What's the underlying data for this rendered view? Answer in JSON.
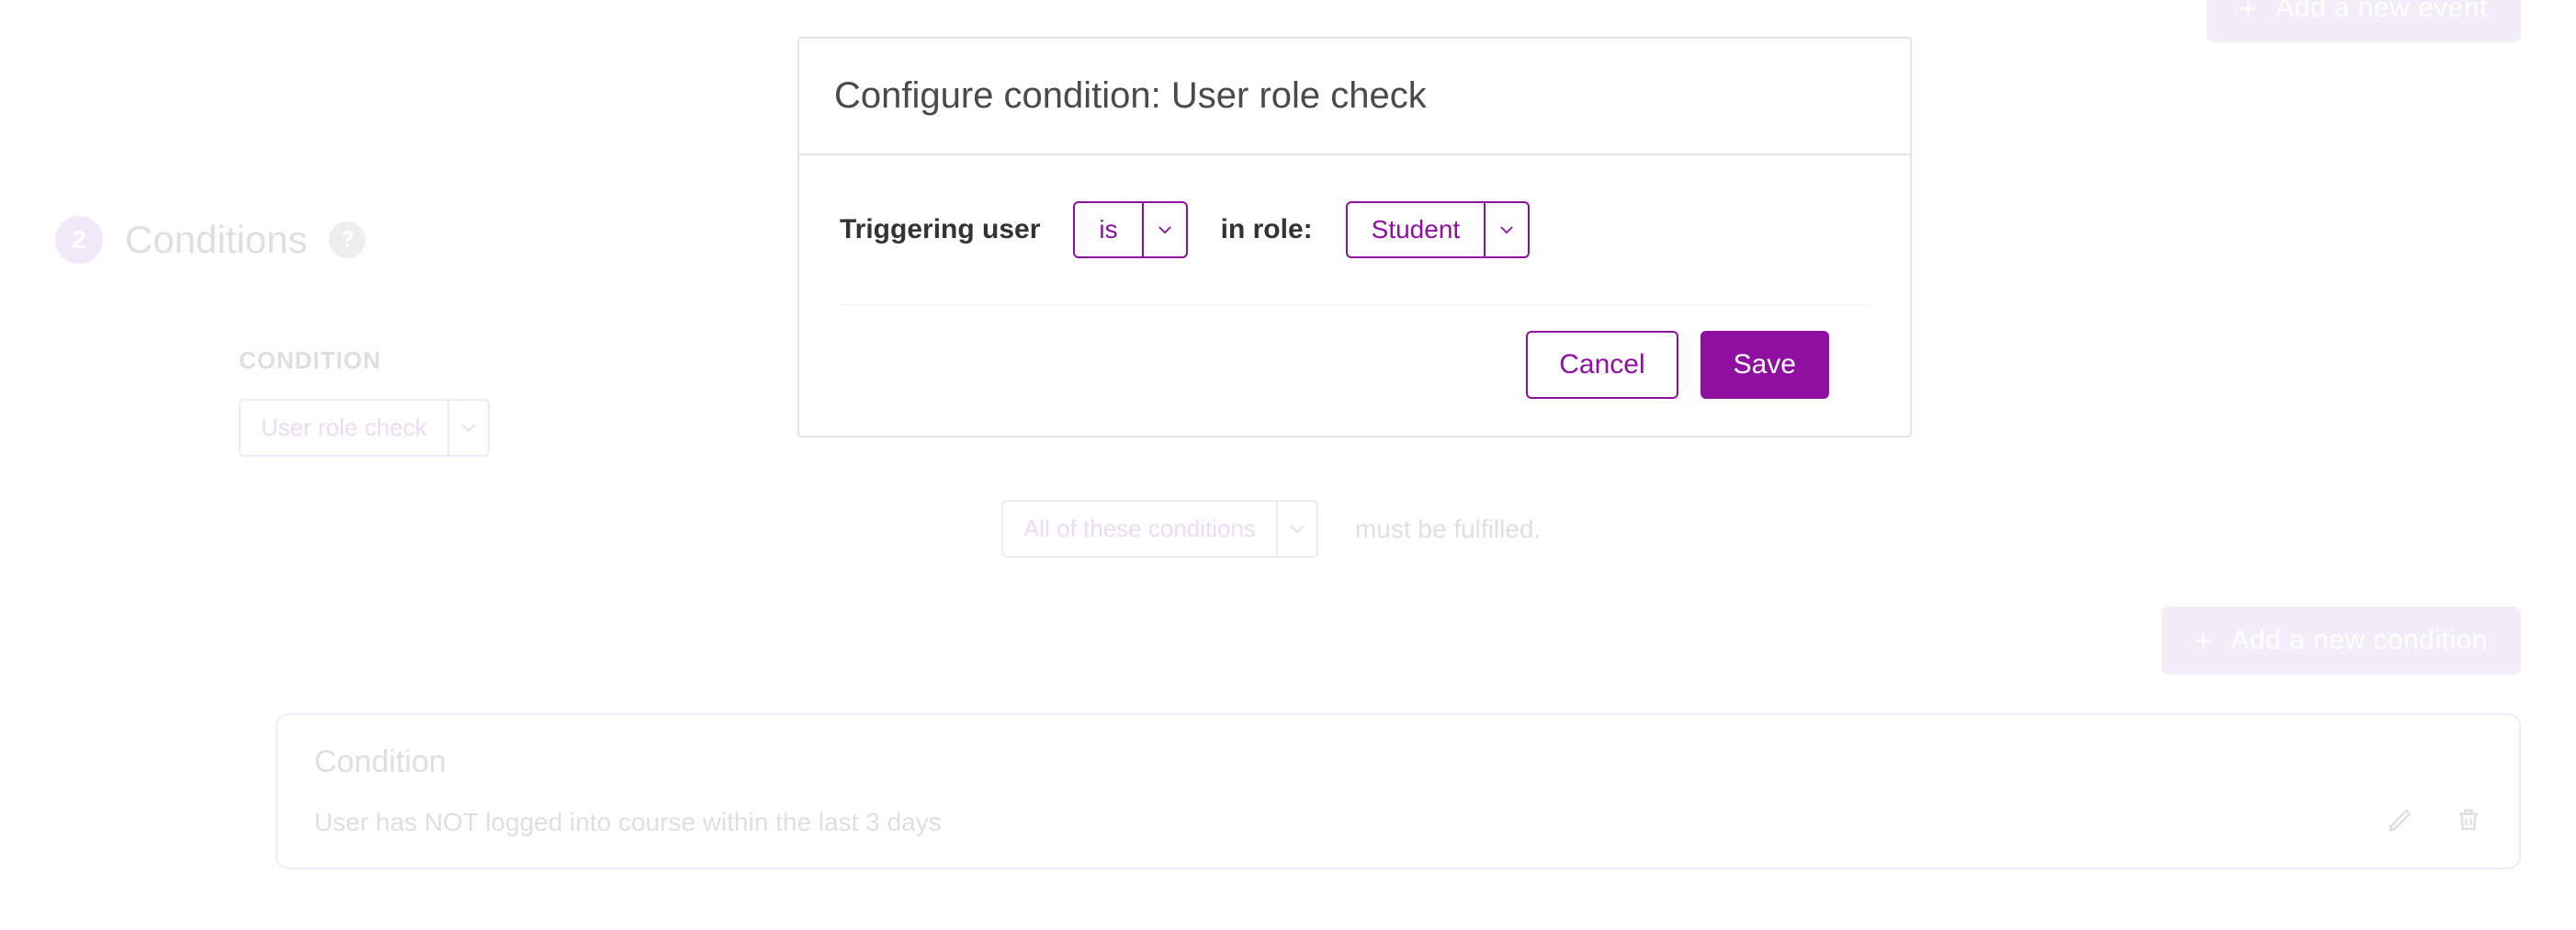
{
  "background": {
    "step": {
      "number": "2",
      "title": "Conditions"
    },
    "condition_label": "CONDITION",
    "user_role_select": "User role check",
    "all_conditions_select": "All of these conditions",
    "must_be": "must be fulfilled.",
    "add_event": "Add a new event",
    "add_condition": "Add a new condition",
    "card": {
      "title": "Condition",
      "desc": "User has NOT logged into course within the last 3 days"
    }
  },
  "dialog": {
    "title": "Configure condition: User role check",
    "label_triggering": "Triggering user",
    "select_is": "is",
    "label_in_role": "in role:",
    "select_role": "Student",
    "cancel": "Cancel",
    "save": "Save"
  }
}
